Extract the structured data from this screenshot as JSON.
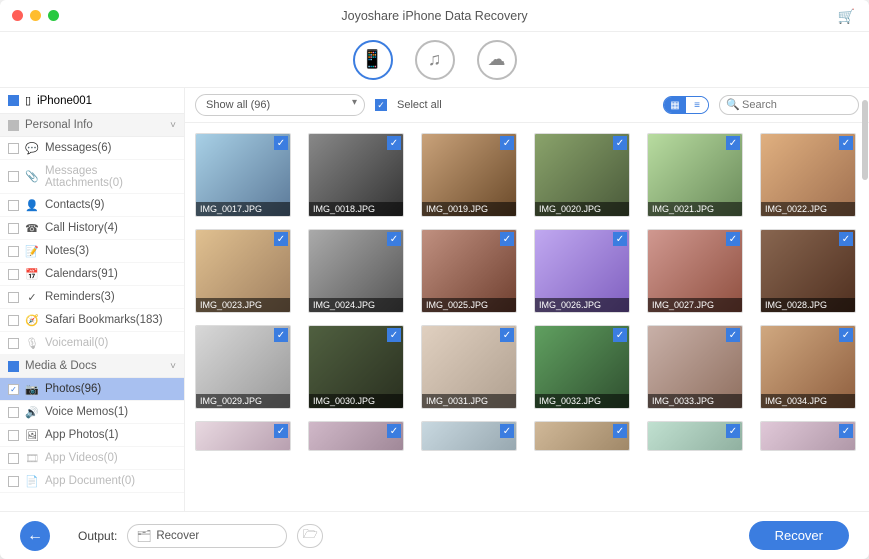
{
  "app_title": "Joyoshare iPhone Data Recovery",
  "device_name": "iPhone001",
  "filter": {
    "selected": "Show all (96)",
    "select_all_label": "Select all"
  },
  "search": {
    "placeholder": "Search"
  },
  "output": {
    "label": "Output:",
    "path": "Recover"
  },
  "recover_button": "Recover",
  "toolbar_tabs": [
    "device",
    "itunes",
    "icloud"
  ],
  "categories": [
    {
      "header": "Personal Info",
      "items": [
        {
          "label": "Messages(6)",
          "icon": "💬",
          "checked": false,
          "enabled": true
        },
        {
          "label": "Messages Attachments(0)",
          "icon": "📎",
          "checked": false,
          "enabled": false
        },
        {
          "label": "Contacts(9)",
          "icon": "👤",
          "checked": false,
          "enabled": true
        },
        {
          "label": "Call History(4)",
          "icon": "☎",
          "checked": false,
          "enabled": true
        },
        {
          "label": "Notes(3)",
          "icon": "📝",
          "checked": false,
          "enabled": true
        },
        {
          "label": "Calendars(91)",
          "icon": "📅",
          "checked": false,
          "enabled": true
        },
        {
          "label": "Reminders(3)",
          "icon": "✓",
          "checked": false,
          "enabled": true
        },
        {
          "label": "Safari Bookmarks(183)",
          "icon": "🧭",
          "checked": false,
          "enabled": true
        },
        {
          "label": "Voicemail(0)",
          "icon": "🎙",
          "checked": false,
          "enabled": false
        }
      ]
    },
    {
      "header": "Media & Docs",
      "items": [
        {
          "label": "Photos(96)",
          "icon": "📷",
          "checked": true,
          "enabled": true,
          "selected": true
        },
        {
          "label": "Voice Memos(1)",
          "icon": "🔊",
          "checked": false,
          "enabled": true
        },
        {
          "label": "App Photos(1)",
          "icon": "🖼",
          "checked": false,
          "enabled": true
        },
        {
          "label": "App Videos(0)",
          "icon": "🎞",
          "checked": false,
          "enabled": false
        },
        {
          "label": "App Document(0)",
          "icon": "📄",
          "checked": false,
          "enabled": false
        }
      ]
    }
  ],
  "thumbnails": [
    {
      "name": "IMG_0017.JPG",
      "g": 0
    },
    {
      "name": "IMG_0018.JPG",
      "g": 1
    },
    {
      "name": "IMG_0019.JPG",
      "g": 2
    },
    {
      "name": "IMG_0020.JPG",
      "g": 3
    },
    {
      "name": "IMG_0021.JPG",
      "g": 4
    },
    {
      "name": "IMG_0022.JPG",
      "g": 5
    },
    {
      "name": "IMG_0023.JPG",
      "g": 6
    },
    {
      "name": "IMG_0024.JPG",
      "g": 7
    },
    {
      "name": "IMG_0025.JPG",
      "g": 8
    },
    {
      "name": "IMG_0026.JPG",
      "g": 9
    },
    {
      "name": "IMG_0027.JPG",
      "g": 10
    },
    {
      "name": "IMG_0028.JPG",
      "g": 11
    },
    {
      "name": "IMG_0029.JPG",
      "g": 12
    },
    {
      "name": "IMG_0030.JPG",
      "g": 13
    },
    {
      "name": "IMG_0031.JPG",
      "g": 14
    },
    {
      "name": "IMG_0032.JPG",
      "g": 15
    },
    {
      "name": "IMG_0033.JPG",
      "g": 16
    },
    {
      "name": "IMG_0034.JPG",
      "g": 17
    }
  ],
  "partial_thumbs": [
    18,
    19,
    20,
    21,
    22,
    23
  ]
}
